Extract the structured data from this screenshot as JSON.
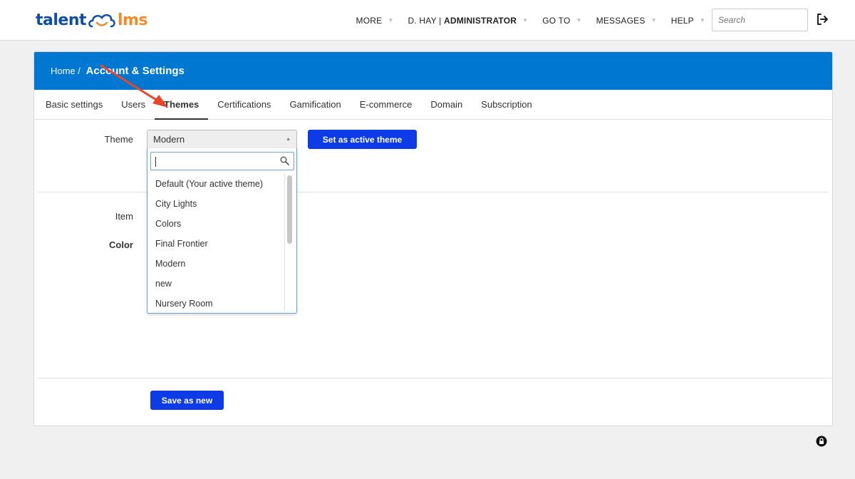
{
  "brand": {
    "left": "talent",
    "right": "lms"
  },
  "topnav": {
    "more": "MORE",
    "user_prefix": "D. HAY | ",
    "user_role": "ADMINISTRATOR",
    "goto": "GO TO",
    "messages": "MESSAGES",
    "help": "HELP",
    "search_placeholder": "Search"
  },
  "header": {
    "home": "Home / ",
    "title": "Account & Settings"
  },
  "tabs": [
    "Basic settings",
    "Users",
    "Themes",
    "Certifications",
    "Gamification",
    "E-commerce",
    "Domain",
    "Subscription"
  ],
  "active_tab": "Themes",
  "form": {
    "theme_label": "Theme",
    "theme_selected": "Modern",
    "set_active_label": "Set as active theme",
    "item_label": "Item",
    "color_label": "Color",
    "save_new_label": "Save as new"
  },
  "dropdown": {
    "options": [
      "Default (Your active theme)",
      "City Lights",
      "Colors",
      "Final Frontier",
      "Modern",
      "new",
      "Nursery Room"
    ]
  },
  "colors": {
    "header_blue": "#0078d2",
    "button_blue": "#0d3ce6",
    "annotation_red": "#e8462a"
  }
}
